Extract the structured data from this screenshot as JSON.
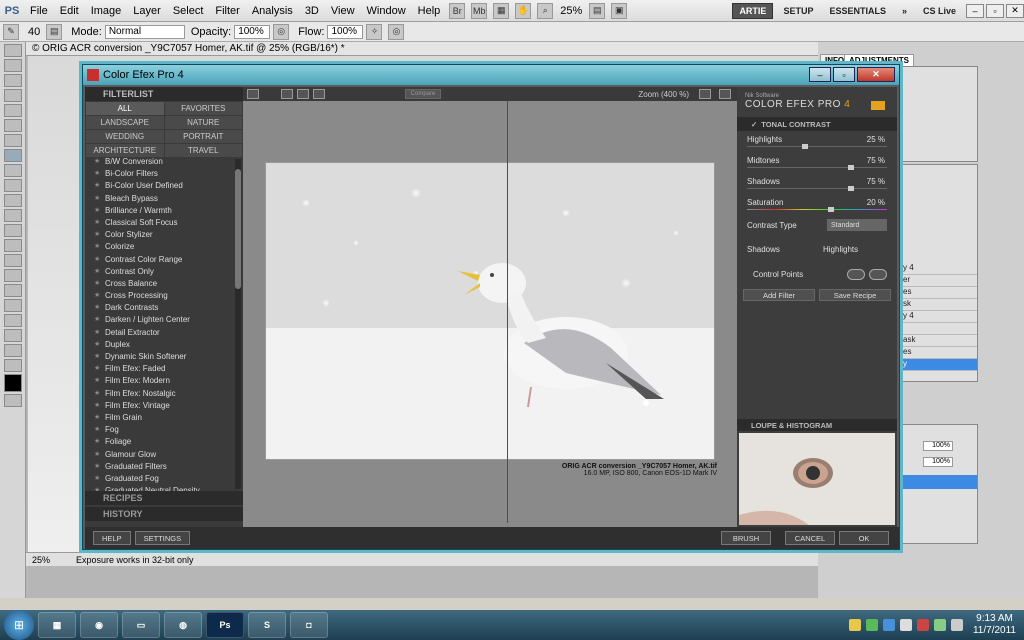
{
  "photoshop": {
    "logo": "PS",
    "menus": [
      "File",
      "Edit",
      "Image",
      "Layer",
      "Select",
      "Filter",
      "Analysis",
      "3D",
      "View",
      "Window",
      "Help"
    ],
    "zoom": "25%",
    "workspaces": [
      "ARTIE",
      "SETUP",
      "ESSENTIALS"
    ],
    "cslive": "CS Live",
    "options": {
      "brush_size": "40",
      "mode_label": "Mode:",
      "mode_value": "Normal",
      "opacity_label": "Opacity:",
      "opacity_value": "100%",
      "flow_label": "Flow:",
      "flow_value": "100%"
    },
    "doc_title": "© ORIG ACR conversion _Y9C7057 Homer, AK.tif @ 25% (RGB/16*) *",
    "status_zoom": "25%",
    "status_msg": "Exposure works in 32-bit only",
    "panels": {
      "tab_info": "INFO",
      "tab_adjustments": "ADJUSTMENTS",
      "layer_rows": [
        "y 4",
        "er",
        "es",
        "sk",
        "y 4",
        "",
        "ask",
        "es",
        "y"
      ],
      "opacity_value": "100%",
      "fill_value": "100%"
    }
  },
  "efex": {
    "title": "Color Efex Pro 4",
    "filterlist_label": "FILTERLIST",
    "categories": [
      "ALL",
      "FAVORITES",
      "LANDSCAPE",
      "NATURE",
      "WEDDING",
      "PORTRAIT",
      "ARCHITECTURE",
      "TRAVEL"
    ],
    "filters": [
      "B/W Conversion",
      "Bi-Color Filters",
      "Bi-Color User Defined",
      "Bleach Bypass",
      "Brilliance / Warmth",
      "Classical Soft Focus",
      "Color Stylizer",
      "Colorize",
      "Contrast Color Range",
      "Contrast Only",
      "Cross Balance",
      "Cross Processing",
      "Dark Contrasts",
      "Darken / Lighten Center",
      "Detail Extractor",
      "Duplex",
      "Dynamic Skin Softener",
      "Film Efex: Faded",
      "Film Efex: Modern",
      "Film Efex: Nostalgic",
      "Film Efex: Vintage",
      "Film Grain",
      "Fog",
      "Foliage",
      "Glamour Glow",
      "Graduated Filters",
      "Graduated Fog",
      "Graduated Neutral Density"
    ],
    "recipes_label": "RECIPES",
    "history_label": "HISTORY",
    "help": "HELP",
    "settings": "SETTINGS",
    "compare": "Compare",
    "zoom": "Zoom (400 %)",
    "caption_line1": "ORIG ACR conversion _Y9C7057  Homer, AK.tif",
    "caption_line2": "16.0 MP, ISO 800, Canon EOS-1D Mark IV",
    "brand_line1": "Nik Software",
    "brand_line2": "COLOR EFEX PRO",
    "brand_version": "4",
    "section_tonal": "TONAL CONTRAST",
    "sliders": [
      {
        "label": "Highlights",
        "value": "25",
        "unit": "%",
        "pos": 0.42
      },
      {
        "label": "Midtones",
        "value": "75",
        "unit": "%",
        "pos": 0.78
      },
      {
        "label": "Shadows",
        "value": "75",
        "unit": "%",
        "pos": 0.78
      },
      {
        "label": "Saturation",
        "value": "20",
        "unit": "%",
        "pos": 0.62
      }
    ],
    "contrast_type_label": "Contrast Type",
    "contrast_type_value": "Standard",
    "shadows_label": "Shadows",
    "highlights_label": "Highlights",
    "control_points": "Control Points",
    "add_filter": "Add Filter",
    "save_recipe": "Save Recipe",
    "loupe_label": "LOUPE & HISTOGRAM",
    "brush": "BRUSH",
    "cancel": "CANCEL",
    "ok": "OK"
  },
  "taskbar": {
    "time": "9:13 AM",
    "date": "11/7/2011"
  }
}
